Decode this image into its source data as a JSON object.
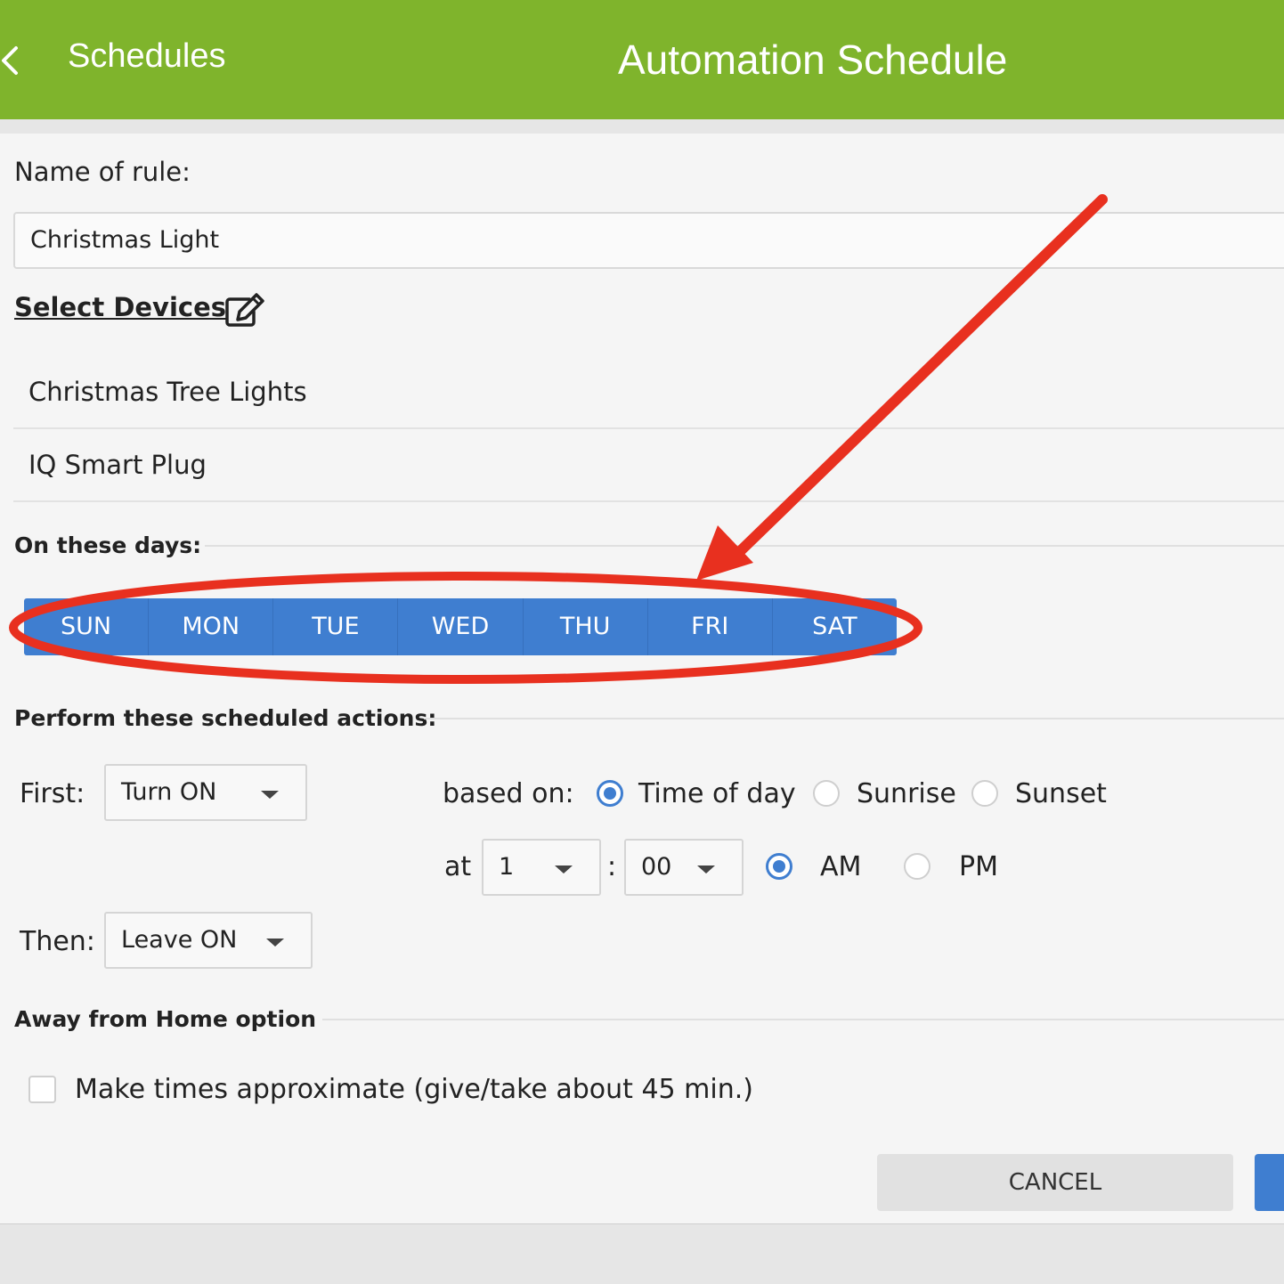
{
  "header": {
    "back_label": "Schedules",
    "title": "Automation Schedule",
    "color": "#7fb42c"
  },
  "form": {
    "name_label": "Name of rule:",
    "name_value": "Christmas Light",
    "select_devices_label": "Select Devices",
    "devices": [
      "Christmas Tree Lights",
      "IQ Smart Plug"
    ],
    "days_title": "On these days:",
    "days": [
      "SUN",
      "MON",
      "TUE",
      "WED",
      "THU",
      "FRI",
      "SAT"
    ],
    "actions_title": "Perform these scheduled actions:",
    "first_label": "First:",
    "first_value": "Turn ON",
    "based_on_label": "based on:",
    "based_on_options": [
      "Time of day",
      "Sunrise",
      "Sunset"
    ],
    "based_on_selected": "Time of day",
    "at_label": "at",
    "hour_value": "1",
    "colon": ":",
    "minute_value": "00",
    "ampm_options": [
      "AM",
      "PM"
    ],
    "ampm_selected": "AM",
    "then_label": "Then:",
    "then_value": "Leave ON",
    "away_title": "Away from Home option",
    "approx_label": "Make times approximate (give/take about 45 min.)",
    "approx_checked": false
  },
  "buttons": {
    "cancel": "CANCEL"
  },
  "accent_color": "#3f7ed0",
  "annotation_color": "#e8301f"
}
